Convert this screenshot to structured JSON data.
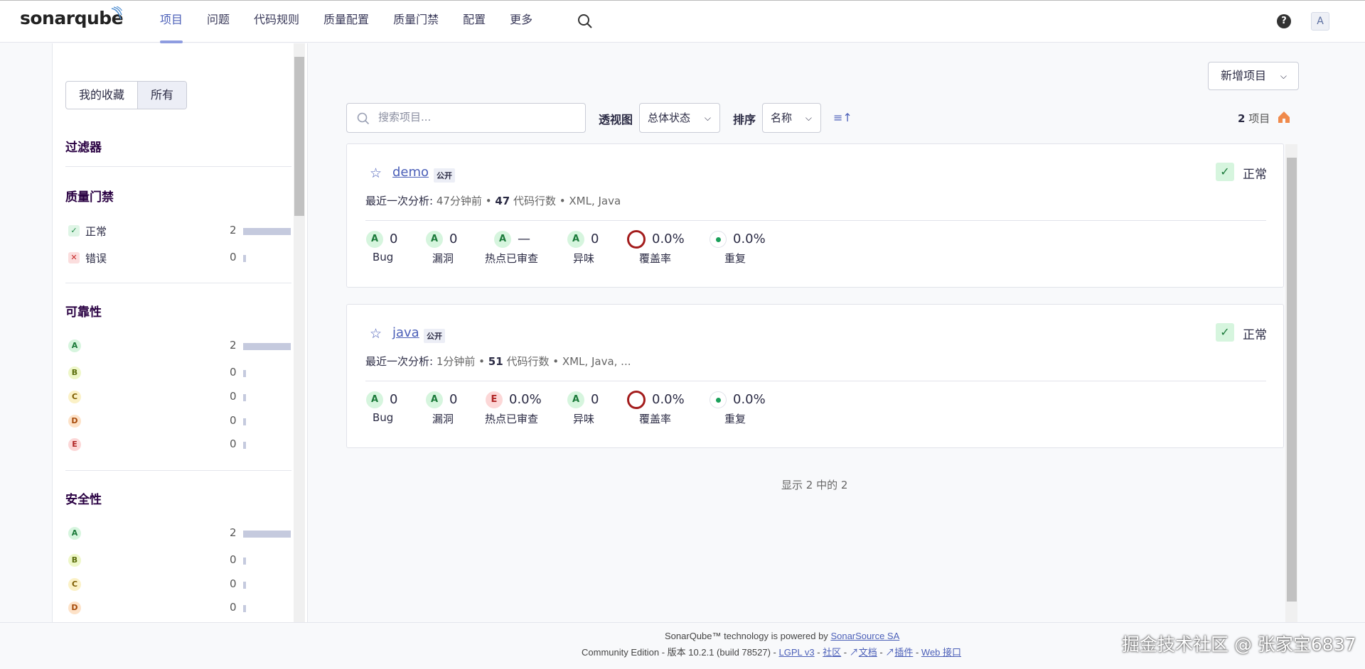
{
  "brand": {
    "name_part1": "sonar",
    "name_part2": "qube"
  },
  "nav": {
    "items": [
      {
        "label": "项目",
        "active": true
      },
      {
        "label": "问题"
      },
      {
        "label": "代码规则"
      },
      {
        "label": "质量配置"
      },
      {
        "label": "质量门禁"
      },
      {
        "label": "配置"
      },
      {
        "label": "更多"
      }
    ],
    "help": "?",
    "avatar": "A"
  },
  "sidebar": {
    "toggle": {
      "favorites": "我的收藏",
      "all": "所有"
    },
    "filters_title": "过滤器",
    "quality_gate": {
      "title": "质量门禁",
      "rows": [
        {
          "label": "正常",
          "count": "2"
        },
        {
          "label": "错误",
          "count": "0"
        }
      ]
    },
    "reliability": {
      "title": "可靠性",
      "rows": [
        {
          "rating": "A",
          "count": "2"
        },
        {
          "rating": "B",
          "count": "0"
        },
        {
          "rating": "C",
          "count": "0"
        },
        {
          "rating": "D",
          "count": "0"
        },
        {
          "rating": "E",
          "count": "0"
        }
      ]
    },
    "security": {
      "title": "安全性",
      "rows": [
        {
          "rating": "A",
          "count": "2"
        },
        {
          "rating": "B",
          "count": "0"
        },
        {
          "rating": "C",
          "count": "0"
        },
        {
          "rating": "D",
          "count": "0"
        }
      ]
    }
  },
  "toolbar": {
    "new_project": "新增项目",
    "search_placeholder": "搜索项目...",
    "view_label": "透视图",
    "view_value": "总体状态",
    "sort_label": "排序",
    "sort_value": "名称",
    "count_number": "2",
    "count_unit": "项目"
  },
  "projects": [
    {
      "name": "demo",
      "visibility": "公开",
      "gate_status": "正常",
      "last_analysis_label": "最近一次分析:",
      "last_analysis": "47分钟前",
      "loc": "47",
      "loc_label": "代码行数",
      "languages": "XML, Java",
      "metrics": {
        "bug": {
          "rating": "A",
          "value": "0",
          "label": "Bug"
        },
        "vuln": {
          "rating": "A",
          "value": "0",
          "label": "漏洞"
        },
        "hotspot": {
          "rating": "A",
          "value": "—",
          "label": "热点已审查"
        },
        "smell": {
          "rating": "A",
          "value": "0",
          "label": "异味"
        },
        "coverage": {
          "value": "0.0%",
          "label": "覆盖率"
        },
        "dup": {
          "value": "0.0%",
          "label": "重复"
        }
      }
    },
    {
      "name": "java",
      "visibility": "公开",
      "gate_status": "正常",
      "last_analysis_label": "最近一次分析:",
      "last_analysis": "1分钟前",
      "loc": "51",
      "loc_label": "代码行数",
      "languages": "XML, Java, ...",
      "metrics": {
        "bug": {
          "rating": "A",
          "value": "0",
          "label": "Bug"
        },
        "vuln": {
          "rating": "A",
          "value": "0",
          "label": "漏洞"
        },
        "hotspot": {
          "rating": "E",
          "value": "0.0%",
          "label": "热点已审查"
        },
        "smell": {
          "rating": "A",
          "value": "0",
          "label": "异味"
        },
        "coverage": {
          "value": "0.0%",
          "label": "覆盖率"
        },
        "dup": {
          "value": "0.0%",
          "label": "重复"
        }
      }
    }
  ],
  "showing": "显示 2 中的 2",
  "footer": {
    "powered_prefix": "SonarQube™ technology is powered by",
    "powered_link": "SonarSource SA",
    "edition": "Community Edition - 版本 10.2.1 (build 78527) -",
    "license": "LGPL v3",
    "community": "社区",
    "docs": "文档",
    "plugins": "插件",
    "webapi": "Web 接口"
  },
  "watermark": "掘金技术社区 @ 张家宝6837",
  "colors": {
    "accent": "#4b5fb8",
    "ok_bg": "#d6f5de",
    "ok_fg": "#1b7a3a",
    "error": "#a31c1c"
  }
}
